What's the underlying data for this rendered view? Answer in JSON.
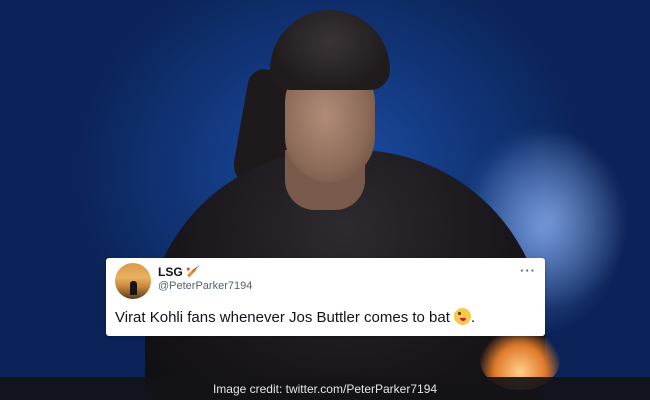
{
  "tweet": {
    "display_name": "LSG",
    "name_emoji": "🏏",
    "handle": "@PeterParker7194",
    "more_icon": "···",
    "text": "Virat Kohli fans whenever Jos Buttler comes to bat",
    "trailing_emoji_name": "zany-face",
    "trailing_punct": "."
  },
  "caption": {
    "text": "Image credit: twitter.com/PeterParker7194"
  },
  "colors": {
    "background_blue": "#12367a",
    "card_bg": "#ffffff",
    "name_color": "#0f1419",
    "handle_color": "#536471"
  }
}
